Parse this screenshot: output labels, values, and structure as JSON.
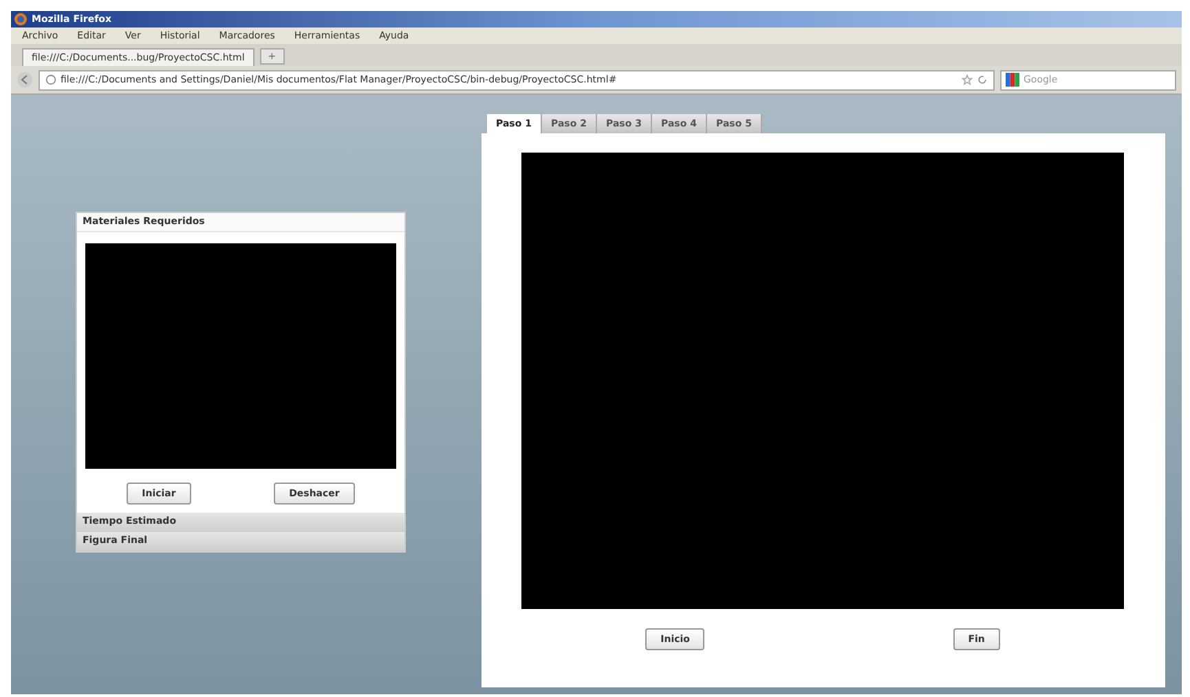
{
  "window": {
    "title": "Mozilla Firefox"
  },
  "menu": [
    "Archivo",
    "Editar",
    "Ver",
    "Historial",
    "Marcadores",
    "Herramientas",
    "Ayuda"
  ],
  "browser_tab": {
    "title": "file:///C:/Documents...bug/ProyectoCSC.html",
    "new_tab": "+"
  },
  "address": {
    "url": "file:///C:/Documents and Settings/Daniel/Mis documentos/Flat Manager/ProyectoCSC/bin-debug/ProyectoCSC.html#",
    "search_placeholder": "Google"
  },
  "left_panel": {
    "sections": [
      {
        "title": "Materiales Requeridos",
        "expanded": true
      },
      {
        "title": "Tiempo Estimado",
        "expanded": false
      },
      {
        "title": "Figura Final",
        "expanded": false
      }
    ],
    "buttons": [
      "Iniciar",
      "Deshacer"
    ]
  },
  "steps": {
    "tabs": [
      {
        "label": "Paso 1",
        "selected": true
      },
      {
        "label": "Paso 2",
        "selected": false
      },
      {
        "label": "Paso 3",
        "selected": false
      },
      {
        "label": "Paso 4",
        "selected": false
      },
      {
        "label": "Paso 5",
        "selected": false
      }
    ],
    "buttons": [
      "Inicio",
      "Fin"
    ]
  }
}
